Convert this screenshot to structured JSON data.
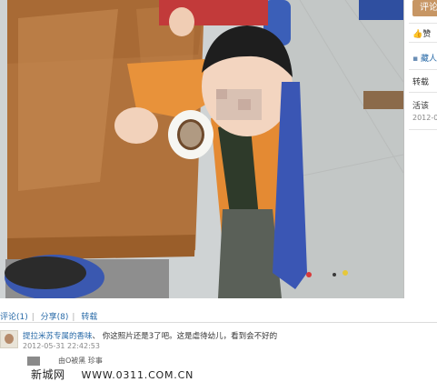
{
  "right_panel": {
    "comment_button": "评论",
    "like": "赞",
    "user": "藏人",
    "repost": "转载",
    "say": "活该",
    "date_fragment": "2012-0"
  },
  "actions": {
    "comment": "评论(1)",
    "share": "分享(8)",
    "repost": "转载"
  },
  "comment": {
    "user": "提拉米苏专属的香味",
    "separator": "、",
    "text": "你这照片还是3了吧。这是虐待幼儿，看到会不好的",
    "timestamp": "2012-05-31 22:42:53"
  },
  "comment2": {
    "text": "由O被黑 珍事"
  },
  "watermark": {
    "site": "新城网",
    "url": "WWW.0311.COM.CN"
  },
  "colors": {
    "accent_button": "#c79664",
    "link": "#2a6ba8"
  }
}
